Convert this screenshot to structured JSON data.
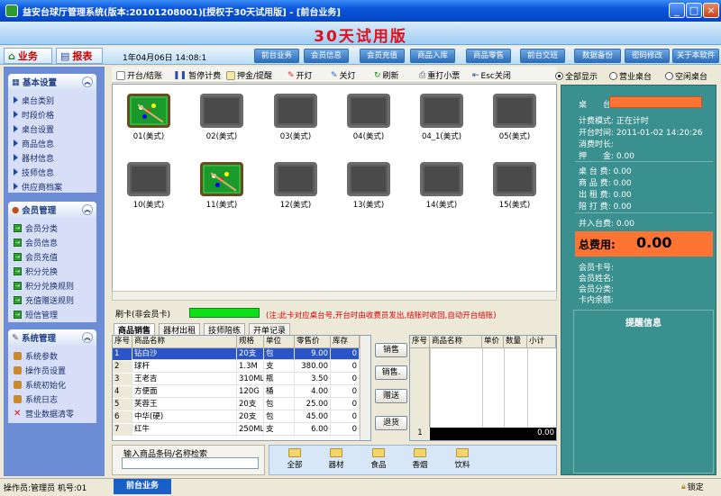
{
  "window": {
    "title": "益安台球厅管理系统(版本:20101208001)[授权于30天试用版] - [前台业务]"
  },
  "banner": {
    "title": "30天试用版"
  },
  "modules": {
    "business": "业务",
    "report": "报表"
  },
  "clock": "1年04月06日  14:08:1",
  "nav": [
    "前台业务",
    "会员信息",
    "会员充值",
    "商品入库",
    "商品零售",
    "前台交班",
    "数据备份",
    "密码修改",
    "关于本软件"
  ],
  "sidebar": {
    "groups": [
      {
        "title": "基本设置",
        "items": [
          "桌台类别",
          "时段价格",
          "桌台设置",
          "商品信息",
          "器材信息",
          "技师信息",
          "供应商档案"
        ]
      },
      {
        "title": "会员管理",
        "items": [
          "会员分类",
          "会员信息",
          "会员充值",
          "积分兑换",
          "积分兑换规则",
          "充值赠送规则",
          "短信管理"
        ]
      },
      {
        "title": "系统管理",
        "items": [
          "系统参数",
          "操作员设置",
          "系统初始化",
          "系统日志",
          "营业数据清零"
        ]
      }
    ]
  },
  "toolbar": {
    "items": [
      "开台/结账",
      "暂停计费",
      "押金/提醒",
      "开灯",
      "关灯",
      "刷新",
      "重打小票",
      "Esc关闭"
    ]
  },
  "filters": {
    "all": "全部显示",
    "busy": "营业桌台",
    "free": "空闲桌台"
  },
  "tables": [
    {
      "label": "01(美式)",
      "busy": true
    },
    {
      "label": "02(美式)",
      "busy": false
    },
    {
      "label": "03(美式)",
      "busy": false
    },
    {
      "label": "04(美式)",
      "busy": false
    },
    {
      "label": "04_1(美式)",
      "busy": false
    },
    {
      "label": "05(美式)",
      "busy": false
    },
    {
      "label": "10(美式)",
      "busy": false
    },
    {
      "label": "11(美式)",
      "busy": true
    },
    {
      "label": "12(美式)",
      "busy": false
    },
    {
      "label": "13(美式)",
      "busy": false
    },
    {
      "label": "14(美式)",
      "busy": false
    },
    {
      "label": "15(美式)",
      "busy": false
    }
  ],
  "card": {
    "label": "刷卡(非会员卡)",
    "note": "(注:此卡对应桌台号,开台时由收费员发出,结账时收回,自动开台结账)"
  },
  "tabs": [
    "商品销售",
    "器材出租",
    "技师陪练",
    "开单记录"
  ],
  "products": {
    "headers": [
      "序号",
      "商品名称",
      "规格",
      "单位",
      "零售价",
      "库存"
    ],
    "rows": [
      [
        "1",
        "钻白沙",
        "20支",
        "包",
        "9.00",
        "0"
      ],
      [
        "2",
        "球杆",
        "1.3M",
        "支",
        "380.00",
        "0"
      ],
      [
        "3",
        "王老吉",
        "310ML",
        "瓶",
        "3.50",
        "0"
      ],
      [
        "4",
        "方便面",
        "120G",
        "桶",
        "4.00",
        "0"
      ],
      [
        "5",
        "芙蓉王",
        "20支",
        "包",
        "25.00",
        "0"
      ],
      [
        "6",
        "中华(硬)",
        "20支",
        "包",
        "45.00",
        "0"
      ],
      [
        "7",
        "红牛",
        "250ML",
        "支",
        "6.00",
        "0"
      ]
    ]
  },
  "actions": [
    "销售",
    "销售.",
    "赠送",
    "退货"
  ],
  "cart": {
    "headers": [
      "序号",
      "商品名称",
      "单价",
      "数量",
      "小计"
    ],
    "footer_index": "1",
    "footer_total": "0.00"
  },
  "search": {
    "label": "输入商品条码/名称检索"
  },
  "categories": [
    "全部",
    "器材",
    "食品",
    "香烟",
    "饮料"
  ],
  "detail": {
    "table_label": "桌　　台:",
    "billing_mode": "计费模式: 正在计时",
    "open_time": "开台时间: 2011-01-02 14:20:26",
    "duration": "消费时长:",
    "deposit": "押　　金: 0.00",
    "table_fee": "桌 台 费: 0.00",
    "goods_fee": "商 品 费: 0.00",
    "rent_fee": "出 租 费: 0.00",
    "coach_fee": "陪 打 费: 0.00",
    "merged_fee": "并入台费: 0.00",
    "total_label": "总费用:",
    "total_value": "0.00",
    "member_card": "会员卡号:",
    "member_name": "会员姓名:",
    "member_type": "会员分类:",
    "card_balance": "卡内余额:"
  },
  "remind": {
    "title": "提醒信息"
  },
  "status": {
    "operator": "操作员:管理员  机号:01",
    "tab": "前台业务",
    "lock": "锁定"
  }
}
